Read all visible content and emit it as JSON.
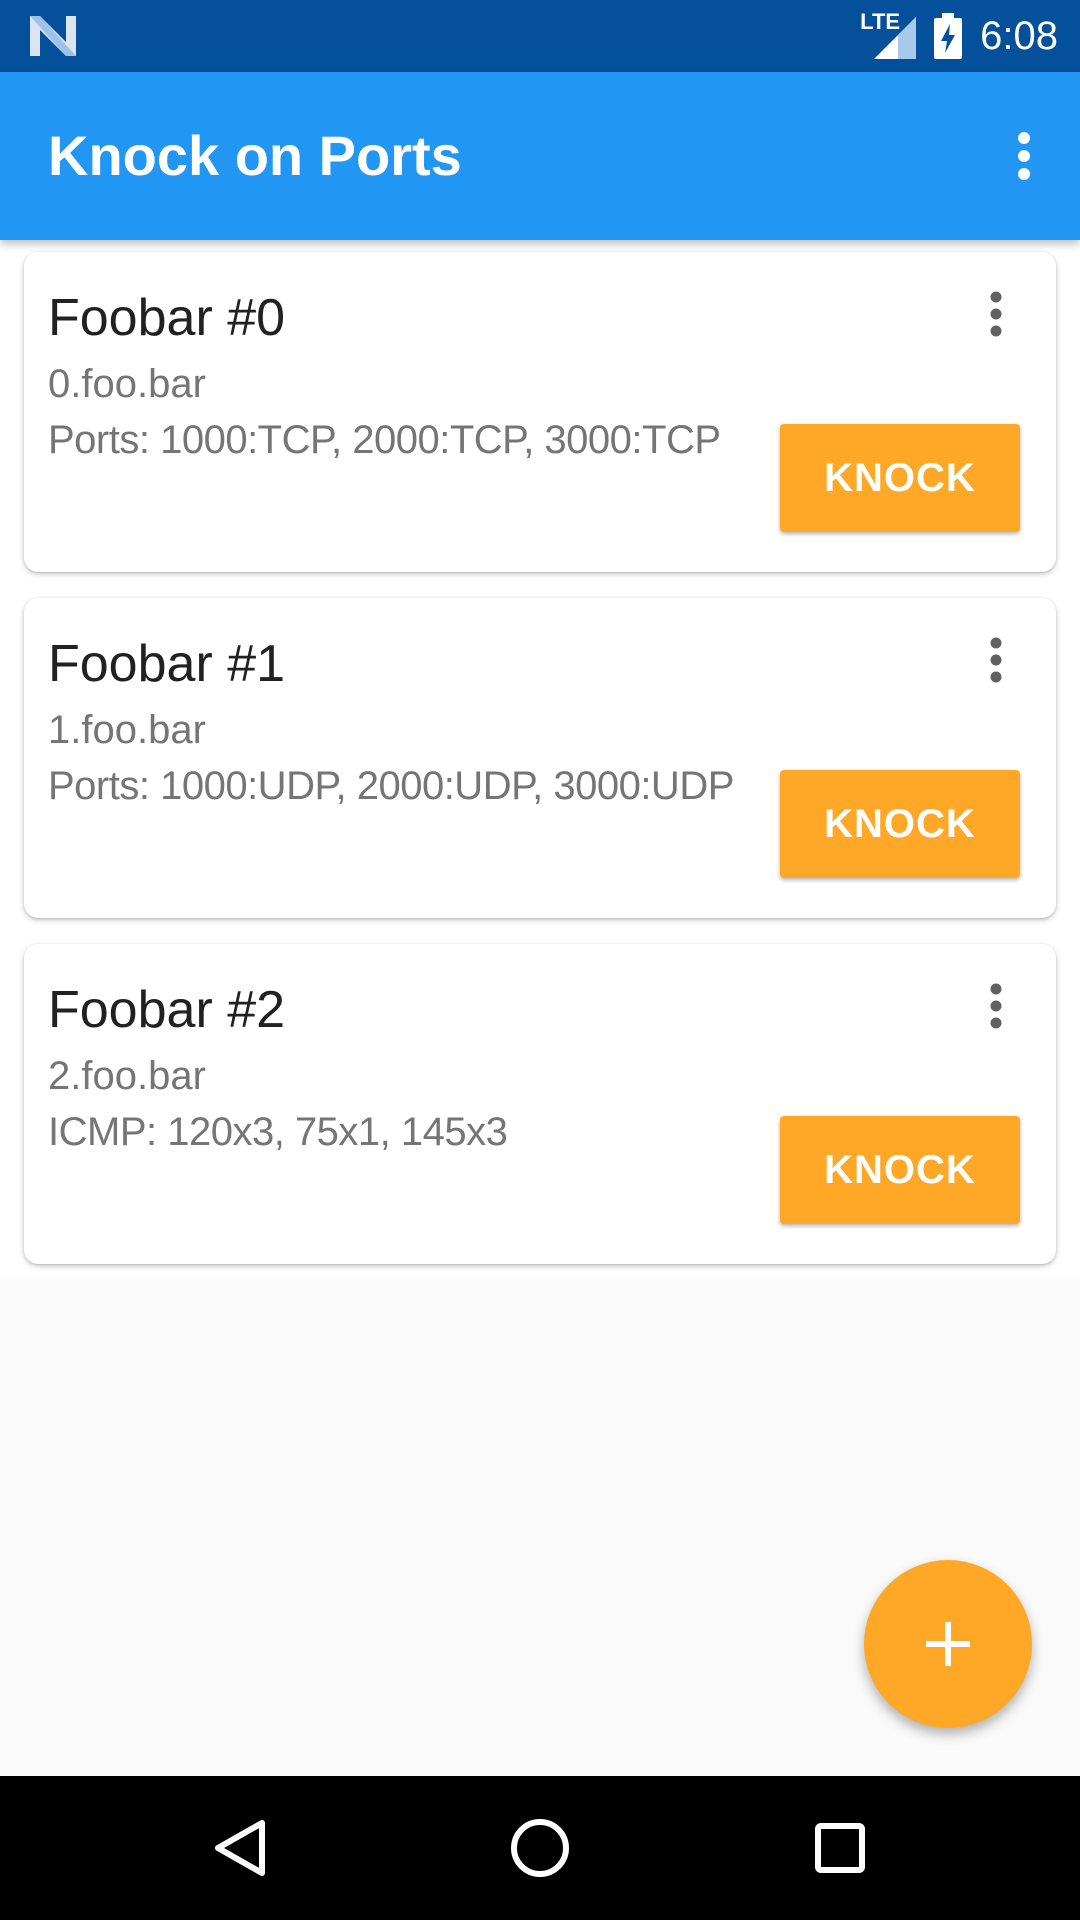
{
  "status_bar": {
    "time": "6:08",
    "network_label": "LTE",
    "left_icon": "n-logo-icon",
    "background": "#05509b"
  },
  "app_bar": {
    "title": "Knock on Ports",
    "background": "#2196f3",
    "menu_icon": "more-vert-icon"
  },
  "cards": [
    {
      "title": "Foobar #0",
      "host": "0.foo.bar",
      "ports": "Ports: 1000:TCP, 2000:TCP, 3000:TCP",
      "button_label": "KNOCK"
    },
    {
      "title": "Foobar #1",
      "host": "1.foo.bar",
      "ports": "Ports: 1000:UDP, 2000:UDP, 3000:UDP",
      "button_label": "KNOCK"
    },
    {
      "title": "Foobar #2",
      "host": "2.foo.bar",
      "ports": "ICMP: 120x3, 75x1, 145x3",
      "button_label": "KNOCK"
    }
  ],
  "fab": {
    "icon": "plus-icon",
    "color": "#ffa726"
  },
  "nav_bar": {
    "back_icon": "back-triangle-icon",
    "home_icon": "home-circle-icon",
    "recents_icon": "recents-square-icon"
  },
  "accent_color": "#ffa726"
}
